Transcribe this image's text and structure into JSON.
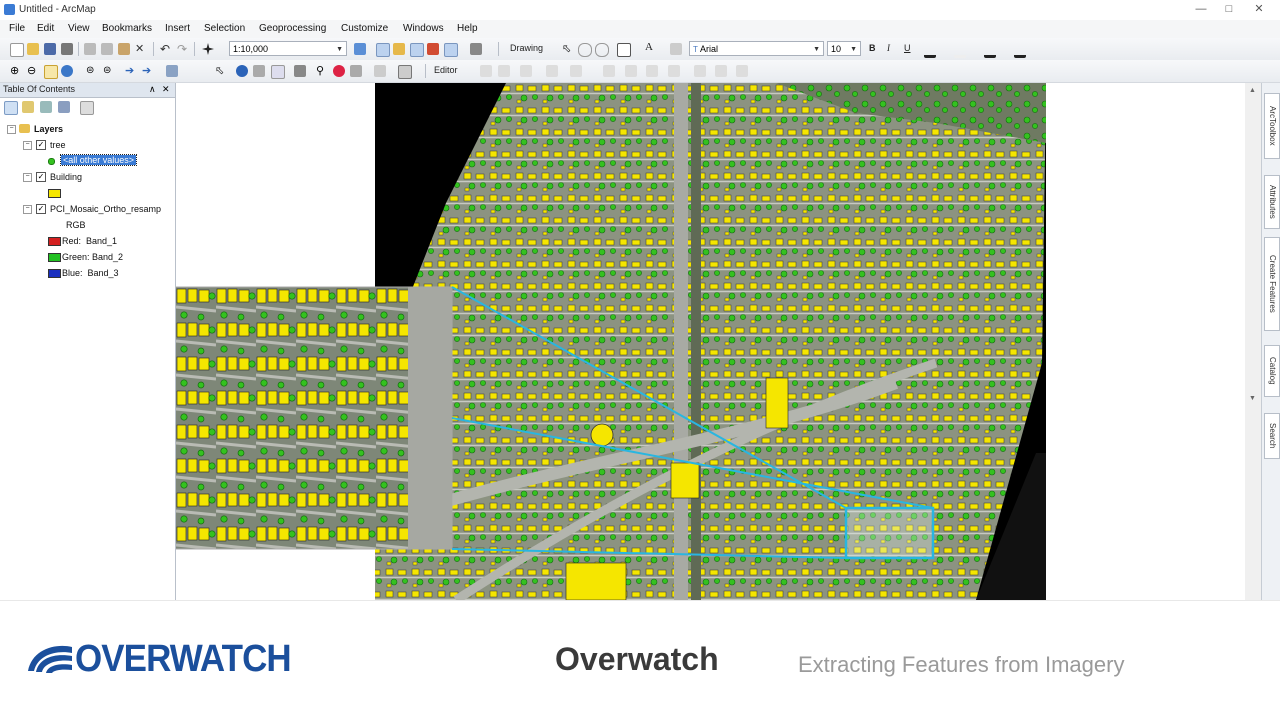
{
  "window": {
    "title": "Untitled - ArcMap"
  },
  "menu": [
    "File",
    "Edit",
    "View",
    "Bookmarks",
    "Insert",
    "Selection",
    "Geoprocessing",
    "Customize",
    "Windows",
    "Help"
  ],
  "toolbar": {
    "scale": "1:10,000",
    "drawing_label": "Drawing",
    "font_name": "Arial",
    "font_size": "10",
    "bold": "B",
    "italic": "I",
    "underline": "U",
    "text_tool": "A",
    "editor_label": "Editor"
  },
  "toc": {
    "header": "Table Of Contents",
    "layers_label": "Layers",
    "layers": [
      {
        "name": "tree",
        "legend": "<all other values>"
      },
      {
        "name": "Building"
      },
      {
        "name": "PCI_Mosaic_Ortho_resamp",
        "legend": "RGB",
        "bands": [
          {
            "label": "Red:",
            "band": "Band_1",
            "color": "#d42020"
          },
          {
            "label": "Green:",
            "band": "Band_2",
            "color": "#22c022"
          },
          {
            "label": "Blue:",
            "band": "Band_3",
            "color": "#1a2fbf"
          }
        ]
      }
    ]
  },
  "right_dock": [
    "ArcToolbox",
    "Attributes",
    "Create Features",
    "Catalog",
    "Search"
  ],
  "footer": {
    "logo_text": "OVERWATCH",
    "title": "Overwatch",
    "subtitle": "Extracting Features from Imagery"
  },
  "colors": {
    "building_fill": "#f5e600",
    "tree_fill": "#34c21f",
    "highlight_box": "#29b6e0",
    "logo_blue": "#1b4f9c"
  }
}
